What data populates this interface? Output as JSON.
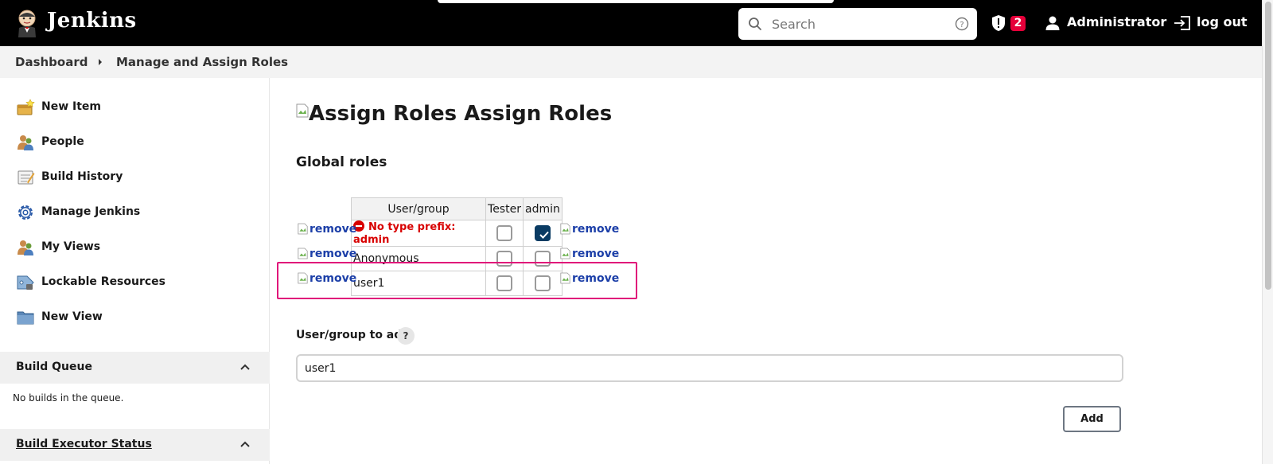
{
  "header": {
    "brand": "Jenkins",
    "search": {
      "placeholder": "Search"
    },
    "security_badge_count": "2",
    "user": "Administrator",
    "logout": "log out"
  },
  "breadcrumb": {
    "items": [
      "Dashboard",
      "Manage and Assign Roles"
    ]
  },
  "sidebar": {
    "items": [
      {
        "label": "New Item",
        "icon": "new-item-icon"
      },
      {
        "label": "People",
        "icon": "people-icon"
      },
      {
        "label": "Build History",
        "icon": "build-history-icon"
      },
      {
        "label": "Manage Jenkins",
        "icon": "gear-icon"
      },
      {
        "label": "My Views",
        "icon": "people-icon"
      },
      {
        "label": "Lockable Resources",
        "icon": "lockable-resources-icon"
      },
      {
        "label": "New View",
        "icon": "folder-icon"
      }
    ],
    "build_queue": {
      "title": "Build Queue",
      "empty_text": "No builds in the queue."
    },
    "executor_status": {
      "title": "Build Executor Status"
    }
  },
  "main": {
    "title_alt": "Assign Roles",
    "title": "Assign Roles",
    "section_title": "Global roles",
    "table": {
      "headers": [
        "User/group",
        "Tester",
        "admin"
      ],
      "rows": [
        {
          "name": "No type prefix: admin",
          "warning": true,
          "tester": false,
          "admin": true
        },
        {
          "name": "Anonymous",
          "warning": false,
          "tester": false,
          "admin": false
        },
        {
          "name": "user1",
          "warning": false,
          "tester": false,
          "admin": false
        }
      ],
      "remove_label": "remove"
    },
    "add_field": {
      "label": "User/group to add",
      "help": "?",
      "value": "user1"
    },
    "add_button": "Add"
  },
  "colors": {
    "header_bg": "#000000",
    "badge": "#e6003a",
    "warning": "#d80000",
    "checked": "#0a3b63",
    "highlight": "#e0157a",
    "link": "#1c3fa8"
  }
}
